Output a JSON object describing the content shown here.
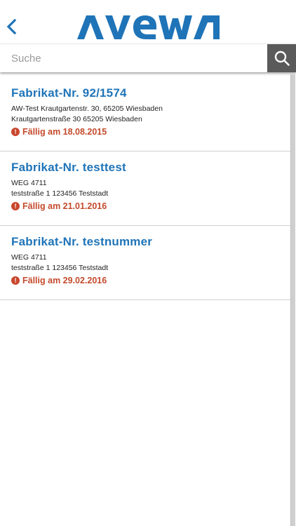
{
  "header": {
    "back_icon": "chevron-left-icon",
    "logo_text": "AVEWA",
    "brand_color": "#1f74b8"
  },
  "search": {
    "placeholder": "Suche",
    "value": "",
    "button_icon": "search-icon"
  },
  "items": [
    {
      "title": "Fabrikat-Nr. 92/1574",
      "line1": "AW-Test Krautgartenstr. 30, 65205 Wiesbaden",
      "line2": "Krautgartenstraße 30 65205 Wiesbaden",
      "due": "Fällig am 18.08.2015"
    },
    {
      "title": "Fabrikat-Nr. testtest",
      "line1": "WEG 4711",
      "line2": "teststraße 1 123456 Teststadt",
      "due": "Fällig am 21.01.2016"
    },
    {
      "title": "Fabrikat-Nr. testnummer",
      "line1": "WEG 4711",
      "line2": "teststraße 1 123456 Teststadt",
      "due": "Fällig am 29.02.2016"
    }
  ],
  "colors": {
    "accent": "#1f74b8",
    "due": "#c44a2c",
    "search_button": "#5a5a5a"
  }
}
